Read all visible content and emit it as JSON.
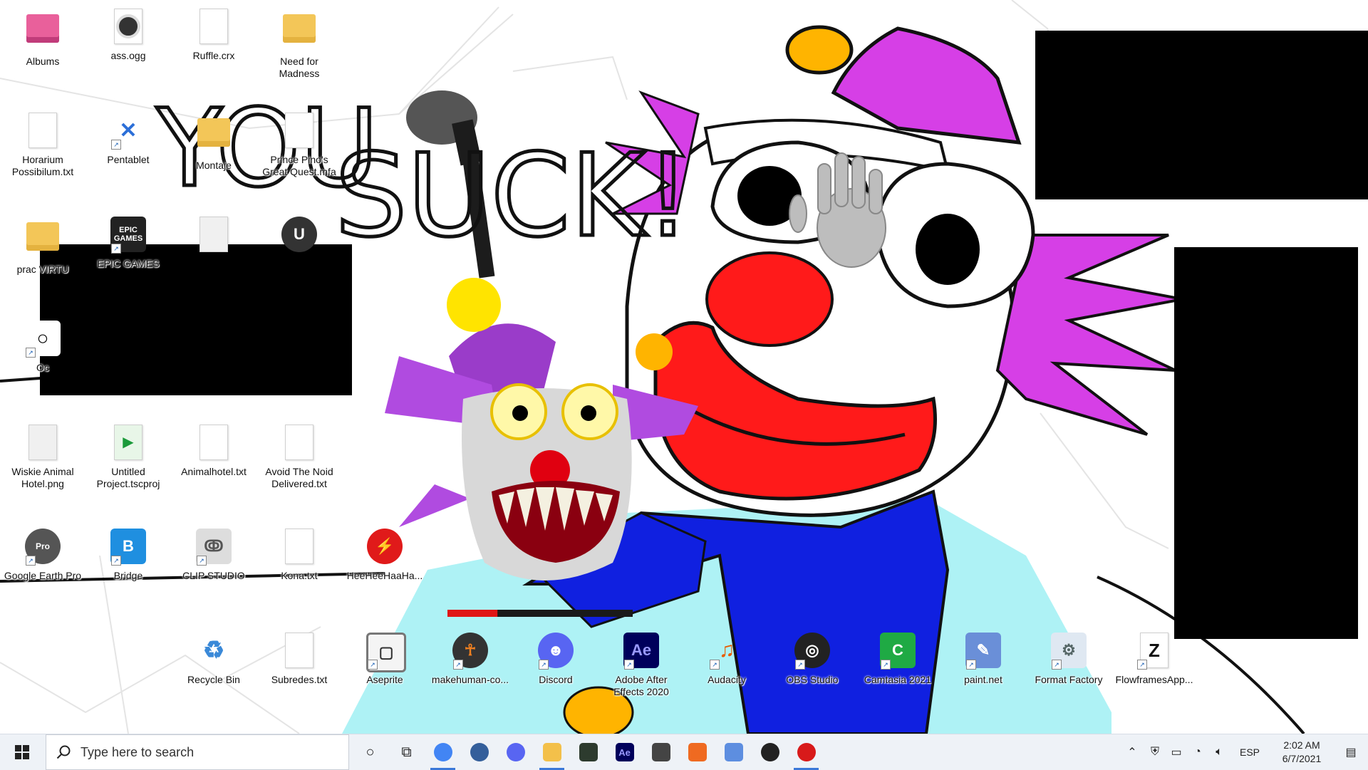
{
  "desktop": {
    "row1": [
      {
        "label": "Albums",
        "kind": "folder-pink"
      },
      {
        "label": "ass.ogg",
        "kind": "audio"
      },
      {
        "label": "Ruffle.crx",
        "kind": "file"
      },
      {
        "label": "Need for Madness",
        "kind": "folder"
      }
    ],
    "row2": [
      {
        "label": "Horarium Possibilum.txt",
        "kind": "file"
      },
      {
        "label": "Pentablet",
        "kind": "pentablet"
      },
      {
        "label": "Montaje",
        "kind": "folder"
      },
      {
        "label": "Prince Pino's Great Quest.mfa",
        "kind": "file"
      }
    ],
    "row3": [
      {
        "label": "prac VIRTU",
        "kind": "chrome-folder"
      },
      {
        "label": "EPIC GAMES",
        "kind": "epic"
      },
      {
        "label": "",
        "kind": "image"
      },
      {
        "label": "",
        "kind": "unreal"
      }
    ],
    "row4": [
      {
        "label": "Oc",
        "kind": "shortcut"
      }
    ],
    "row5": [
      {
        "label": "Wiskie Animal Hotel.png",
        "kind": "image"
      },
      {
        "label": "Untitled Project.tscproj",
        "kind": "camtasia-proj"
      },
      {
        "label": "Animalhotel.txt",
        "kind": "file"
      },
      {
        "label": "Avoid The Noid Delivered.txt",
        "kind": "file"
      }
    ],
    "row6": [
      {
        "label": "Google Earth Pro",
        "kind": "earth"
      },
      {
        "label": "Bridge",
        "kind": "bridge"
      },
      {
        "label": "CLIP STUDIO",
        "kind": "clip"
      },
      {
        "label": "Kona.txt",
        "kind": "file"
      },
      {
        "label": "HeeHeeHaaHa...",
        "kind": "flash"
      }
    ],
    "row7": [
      {
        "label": "Recycle Bin",
        "kind": "recycle"
      },
      {
        "label": "Subredes.txt",
        "kind": "file"
      },
      {
        "label": "Aseprite",
        "kind": "aseprite"
      },
      {
        "label": "makehuman-co...",
        "kind": "makehuman"
      },
      {
        "label": "Discord",
        "kind": "discord"
      },
      {
        "label": "Adobe After Effects 2020",
        "kind": "ae"
      },
      {
        "label": "Audacity",
        "kind": "audacity"
      },
      {
        "label": "OBS Studio",
        "kind": "obs"
      },
      {
        "label": "Camtasia 2021",
        "kind": "camtasia"
      },
      {
        "label": "paint.net",
        "kind": "paintnet"
      },
      {
        "label": "Format Factory",
        "kind": "formatfactory"
      },
      {
        "label": "FlowframesApp...",
        "kind": "flowframes"
      }
    ]
  },
  "scribble": {
    "you": "YOU",
    "suck": "SUCK!"
  },
  "health_bar": {
    "fraction": 0.27
  },
  "taskbar": {
    "search_placeholder": "Type here to search",
    "pinned": [
      {
        "name": "cortana",
        "glyph": "○"
      },
      {
        "name": "task-view",
        "glyph": "⧉"
      },
      {
        "name": "chrome",
        "glyph": "",
        "running": true
      },
      {
        "name": "blender",
        "glyph": ""
      },
      {
        "name": "discord",
        "glyph": ""
      },
      {
        "name": "file-explorer",
        "glyph": "",
        "running": true
      },
      {
        "name": "aseprite-dark",
        "glyph": ""
      },
      {
        "name": "after-effects",
        "glyph": "Ae"
      },
      {
        "name": "ninja-app",
        "glyph": ""
      },
      {
        "name": "clown-app",
        "glyph": ""
      },
      {
        "name": "paint-app",
        "glyph": ""
      },
      {
        "name": "obs",
        "glyph": ""
      },
      {
        "name": "flash-player",
        "glyph": "",
        "running": true
      }
    ],
    "tray": {
      "language": "ESP",
      "time": "2:02 AM",
      "date": "6/7/2021"
    }
  },
  "colors": {
    "clown_purple": "#d63fe6",
    "clown_red": "#ff1a1a",
    "clown_blue": "#1020e0",
    "shirt_cyan": "#aef2f5",
    "yellow": "#ffb400"
  }
}
